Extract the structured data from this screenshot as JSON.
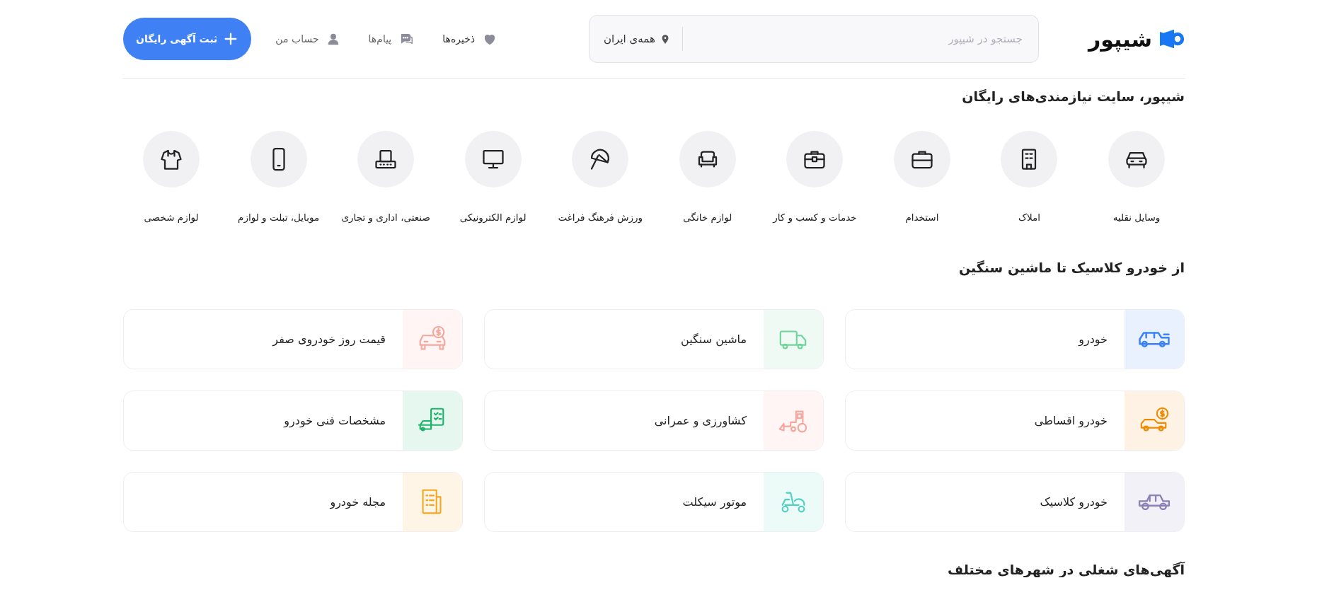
{
  "header": {
    "logo": "شیپور",
    "search": {
      "placeholder": "جستجو در شیپور"
    },
    "location": "همه‌ی ایران",
    "nav": [
      {
        "label": "ذخیره‌ها"
      },
      {
        "label": "پیام‌ها"
      },
      {
        "label": "حساب من"
      }
    ],
    "post_button": "ثبت آگهی رایگان"
  },
  "intro_title": "شیپور، سایت نیازمندی‌های رایگان",
  "categories": [
    {
      "label": "وسایل نقلیه"
    },
    {
      "label": "املاک"
    },
    {
      "label": "استخدام"
    },
    {
      "label": "خدمات و کسب و کار"
    },
    {
      "label": "لوازم خانگی"
    },
    {
      "label": "ورزش فرهنگ فراغت"
    },
    {
      "label": "لوازم الکترونیکی"
    },
    {
      "label": "صنعتی، اداری و تجاری"
    },
    {
      "label": "موبایل، تبلت و لوازم"
    },
    {
      "label": "لوازم شخصی"
    }
  ],
  "vehicles": {
    "title": "از خودرو کلاسیک تا ماشین سنگین",
    "cards": [
      {
        "label": "خودرو",
        "color": "#3b82f6"
      },
      {
        "label": "ماشین سنگین",
        "color": "#6fd49a"
      },
      {
        "label": "قیمت روز خودروی صفر",
        "color": "#f4a79d"
      },
      {
        "label": "خودرو اقساطی",
        "color": "#f08a00"
      },
      {
        "label": "کشاورزی و عمرانی",
        "color": "#f4a79d"
      },
      {
        "label": "مشخصات فنی خودرو",
        "color": "#1eb36b"
      },
      {
        "label": "خودرو کلاسیک",
        "color": "#8a7fb6"
      },
      {
        "label": "موتور سیکلت",
        "color": "#4fd1c0"
      },
      {
        "label": "مجله خودرو",
        "color": "#f5a623"
      }
    ]
  },
  "jobs": {
    "title": "آگهی‌های شغلی در شهرهای مختلف"
  }
}
